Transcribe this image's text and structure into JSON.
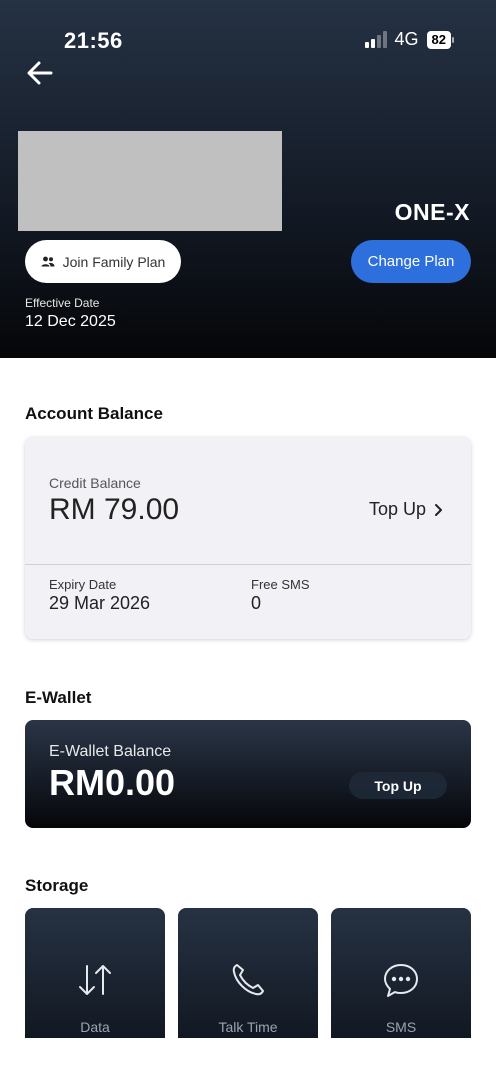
{
  "status_bar": {
    "time": "21:56",
    "network": "4G",
    "battery": "82"
  },
  "header": {
    "plan_name": "ONE-X",
    "join_family_label": "Join Family Plan",
    "change_plan_label": "Change Plan",
    "effective_date_label": "Effective Date",
    "effective_date_value": "12 Dec 2025"
  },
  "account_balance": {
    "title": "Account Balance",
    "credit_label": "Credit Balance",
    "credit_value": "RM 79.00",
    "topup_label": "Top Up",
    "expiry_label": "Expiry Date",
    "expiry_value": "29 Mar 2026",
    "sms_label": "Free SMS",
    "sms_value": "0"
  },
  "ewallet": {
    "title": "E-Wallet",
    "balance_label": "E-Wallet Balance",
    "balance_value": "RM0.00",
    "topup_label": "Top Up"
  },
  "storage": {
    "title": "Storage",
    "items": [
      {
        "label": "Data",
        "icon": "data-transfer-icon"
      },
      {
        "label": "Talk Time",
        "icon": "phone-icon"
      },
      {
        "label": "SMS",
        "icon": "sms-icon"
      }
    ]
  },
  "colors": {
    "accent": "#2d6fdc",
    "header_dark": "#050608",
    "card_bg": "#f2f1f6"
  }
}
